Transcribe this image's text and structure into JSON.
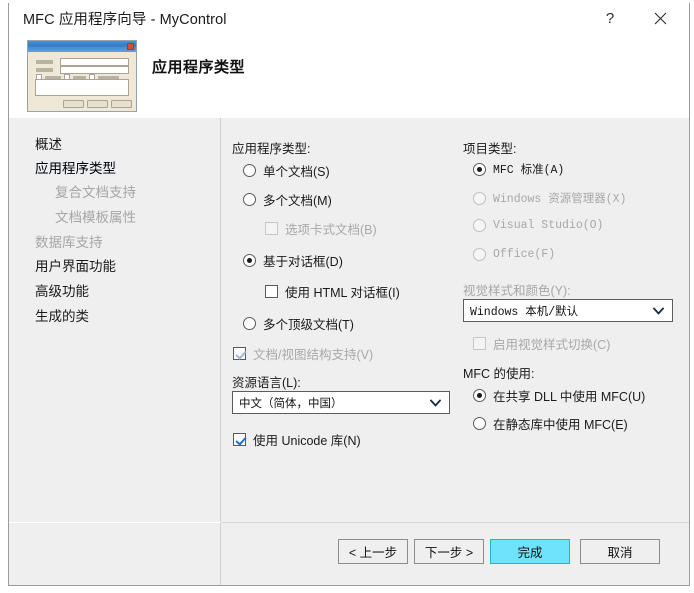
{
  "window": {
    "title": "MFC 应用程序向导 - MyControl",
    "help_label": "?",
    "close_label": "×"
  },
  "header": {
    "heading": "应用程序类型",
    "thumbnail_name": "dialog-preview-thumbnail"
  },
  "sidebar": {
    "items": [
      {
        "label": "概述",
        "state": "normal",
        "indent": false
      },
      {
        "label": "应用程序类型",
        "state": "current",
        "indent": false
      },
      {
        "label": "复合文档支持",
        "state": "disabled",
        "indent": true
      },
      {
        "label": "文档模板属性",
        "state": "disabled",
        "indent": true
      },
      {
        "label": "数据库支持",
        "state": "disabled",
        "indent": false
      },
      {
        "label": "用户界面功能",
        "state": "normal",
        "indent": false
      },
      {
        "label": "高级功能",
        "state": "normal",
        "indent": false
      },
      {
        "label": "生成的类",
        "state": "normal",
        "indent": false
      }
    ]
  },
  "app_type": {
    "group_label": "应用程序类型:",
    "options": [
      {
        "label": "单个文档(S)",
        "type": "radio",
        "checked": false,
        "disabled": false
      },
      {
        "label": "多个文档(M)",
        "type": "radio",
        "checked": false,
        "disabled": false
      },
      {
        "label": "选项卡式文档(B)",
        "type": "checkbox",
        "checked": false,
        "disabled": true
      },
      {
        "label": "基于对话框(D)",
        "type": "radio",
        "checked": true,
        "disabled": false
      },
      {
        "label": "使用 HTML 对话框(I)",
        "type": "checkbox",
        "checked": false,
        "disabled": false
      },
      {
        "label": "多个顶级文档(T)",
        "type": "radio",
        "checked": false,
        "disabled": false
      }
    ],
    "doc_view_support": {
      "label": "文档/视图结构支持(V)",
      "checked": true,
      "disabled": true
    },
    "resource_language": {
      "label": "资源语言(L):",
      "value": "中文（简体，中国）"
    },
    "unicode": {
      "label": "使用 Unicode 库(N)",
      "checked": true,
      "disabled": false
    }
  },
  "project_type": {
    "group_label": "项目类型:",
    "options": [
      {
        "label": "MFC 标准(A)",
        "checked": true,
        "disabled": false
      },
      {
        "label": "Windows 资源管理器(X)",
        "checked": false,
        "disabled": true
      },
      {
        "label": "Visual Studio(O)",
        "checked": false,
        "disabled": true
      },
      {
        "label": "Office(F)",
        "checked": false,
        "disabled": true
      }
    ],
    "visual_style": {
      "label": "视觉样式和颜色(Y):",
      "value": "Windows 本机/默认",
      "disabled": true
    },
    "enable_style_switch": {
      "label": "启用视觉样式切换(C)",
      "checked": false,
      "disabled": true
    },
    "mfc_usage": {
      "group_label": "MFC 的使用:",
      "options": [
        {
          "label": "在共享 DLL 中使用 MFC(U)",
          "checked": true,
          "disabled": false
        },
        {
          "label": "在静态库中使用 MFC(E)",
          "checked": false,
          "disabled": false
        }
      ]
    }
  },
  "footer": {
    "back": "< 上一步",
    "next": "下一步 >",
    "finish": "完成",
    "cancel": "取消"
  },
  "colors": {
    "accent": "#6ee3fb",
    "accent_border": "#1ab4de",
    "panel_bg": "#efefef",
    "divider": "#cfcfcf"
  }
}
